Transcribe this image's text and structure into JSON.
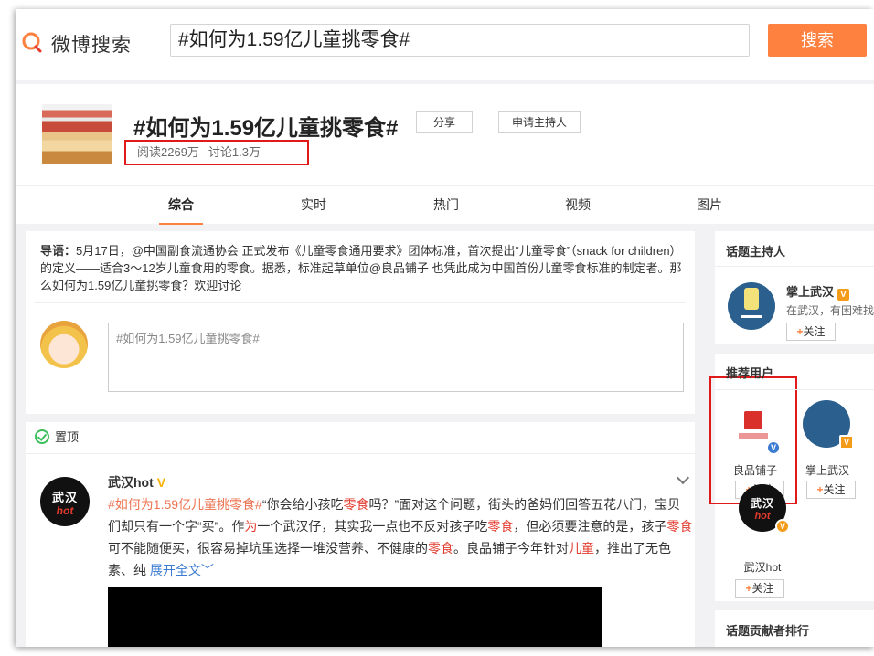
{
  "header": {
    "logo_text": "微博搜索",
    "search_value": "#如何为1.59亿儿童挑零食#",
    "search_button": "搜索"
  },
  "topic": {
    "title": "#如何为1.59亿儿童挑零食#",
    "share_label": "分享",
    "apply_host_label": "申请主持人",
    "reads": "阅读2269万",
    "discussions": "讨论1.3万"
  },
  "tabs": [
    {
      "label": "综合"
    },
    {
      "label": "实时"
    },
    {
      "label": "热门"
    },
    {
      "label": "视频"
    },
    {
      "label": "图片"
    }
  ],
  "intro": {
    "label": "导语：",
    "text": "5月17日，@中国副食流通协会 正式发布《儿童零食通用要求》团体标准，首次提出“儿童零食”（snack for children）的定义——适合3～12岁儿童食用的零食。据悉，标准起草单位@良品铺子 也凭此成为中国首份儿童零食标准的制定者。那么如何为1.59亿儿童挑零食？欢迎讨论"
  },
  "composer": {
    "text": "#如何为1.59亿儿童挑零食#"
  },
  "feed": {
    "pin_label": "置顶",
    "post": {
      "author": "武汉hot",
      "verified_mark": "V",
      "avatar_line1": "武汉",
      "avatar_line2": "hot",
      "segments": [
        {
          "t": "#如何为1.59亿儿童挑零食#",
          "c": "tag"
        },
        {
          "t": "“你会给小孩吃",
          "c": ""
        },
        {
          "t": "零食",
          "c": "hl"
        },
        {
          "t": "吗？”面对这个问题，街头的爸妈们回答五花八门，宝贝们却只有一个字“买”。作",
          "c": ""
        },
        {
          "t": "为",
          "c": "hl"
        },
        {
          "t": "一个武汉仔，其实我一点也不反对孩子吃",
          "c": ""
        },
        {
          "t": "零食",
          "c": "hl"
        },
        {
          "t": "，但必须要注意的是，孩子",
          "c": ""
        },
        {
          "t": "零食",
          "c": "hl"
        },
        {
          "t": "可不能随便买，很容易掉坑里选择一堆没营养、不健康的",
          "c": ""
        },
        {
          "t": "零食",
          "c": "hl"
        },
        {
          "t": "。良品铺子今年针对",
          "c": ""
        },
        {
          "t": "儿童",
          "c": "hl"
        },
        {
          "t": "，推出了无色素、纯 ",
          "c": ""
        },
        {
          "t": "展开全文﹀",
          "c": "more"
        }
      ]
    }
  },
  "sidebar": {
    "host_title": "话题主持人",
    "host": {
      "name": "掌上武汉",
      "verified_mark": "V",
      "desc": "在武汉，有困难找",
      "follow": "关注"
    },
    "recommend_title": "推荐用户",
    "users": [
      {
        "name": "良品铺子",
        "follow": "关注",
        "badge": "V"
      },
      {
        "name": "掌上武汉",
        "follow": "关注",
        "badge": "V"
      },
      {
        "name": "武汉hot",
        "follow": "关注",
        "badge": "V",
        "avatar_line1": "武汉",
        "avatar_line2": "hot"
      }
    ],
    "contrib_title": "话题贡献者排行"
  },
  "colors": {
    "accent": "#ff8140",
    "highlight_box": "#e01a1a",
    "keyword": "#e23b2e",
    "link": "#3a7cd1"
  }
}
